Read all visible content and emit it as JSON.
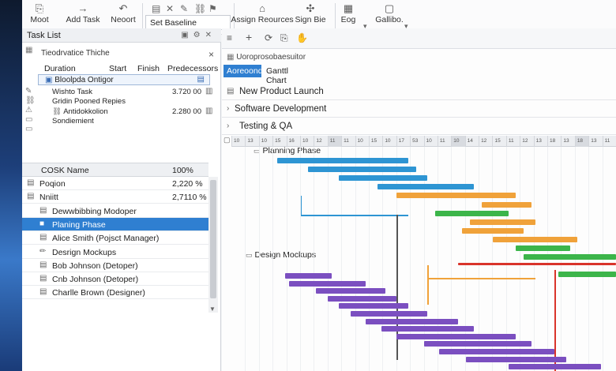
{
  "ribbon": {
    "buttons": [
      {
        "label": "Moot",
        "icon": "⎘"
      },
      {
        "label": "Add Task",
        "icon": "→"
      },
      {
        "label": "Neoort",
        "icon": "↶"
      },
      {
        "label": "Assign Reources",
        "icon": "⌂"
      },
      {
        "label": "Sign Bie",
        "icon": "✣"
      },
      {
        "label": "Eog",
        "icon": "▦"
      },
      {
        "label": "Gallibo.",
        "icon": "▢"
      }
    ],
    "baseline_label": "Set Baseline",
    "dropdown_arrow": "▾"
  },
  "task_list": {
    "title": "Task List",
    "properties_title": "Tieodrvatice Thiche",
    "close": "×",
    "columns": [
      "Duration",
      "Start",
      "Finish",
      "Predecessors"
    ],
    "selected_prop": "Bloolpda Ontigor",
    "props": [
      {
        "name": "Wishto Task",
        "value": "3.720 00"
      },
      {
        "name": "Gridin Pooned Repies",
        "value": ""
      },
      {
        "name": "Antidokkolion",
        "value": "2.280 00"
      },
      {
        "name": "Sondiemient",
        "value": ""
      }
    ],
    "grid_columns": [
      "COSK Name",
      "100%"
    ],
    "rows": [
      {
        "name": "Poqion",
        "pct": "2,220 %"
      },
      {
        "name": "Nniitt",
        "pct": "2,7110 %"
      },
      {
        "name": "Dewwbibbing Modoper",
        "pct": ""
      },
      {
        "name": "Planing Phase",
        "pct": "",
        "selected": true
      },
      {
        "name": "Alice Smith (Pojsct Manager)",
        "pct": ""
      },
      {
        "name": "Desrign Mockups",
        "pct": ""
      },
      {
        "name": "Bob Johnson (Detoper)",
        "pct": ""
      },
      {
        "name": "Cnb Johnson (Detoper)",
        "pct": ""
      },
      {
        "name": "Charlle Brown (Designer)",
        "pct": ""
      }
    ]
  },
  "gantt": {
    "toolbar_title": "Uoroprosobaesuitor",
    "tabs": [
      "Aoreoonde",
      "Ganttl Chart"
    ],
    "sections": [
      "New Product Launch",
      "Software Development",
      "Testing & QA"
    ],
    "ticks": [
      "10",
      "13",
      "10",
      "15",
      "16",
      "10",
      "12",
      "11",
      "11",
      "10",
      "15",
      "10",
      "17",
      "53",
      "10",
      "11",
      "10",
      "14",
      "12",
      "15",
      "11",
      "12",
      "13",
      "18",
      "13",
      "18",
      "13",
      "11"
    ],
    "labels": {
      "planning": "Planning Phase",
      "design": "Design Mockups"
    },
    "colors": {
      "blue": "#2e95d3",
      "orange": "#f0a23a",
      "green": "#3cb54a",
      "red": "#d9342b",
      "purple": "#7b4fc0",
      "accent": "#2f7fd1"
    },
    "bars": [
      {
        "color": "blue",
        "start": 0.12,
        "end": 0.46,
        "row": 0
      },
      {
        "color": "blue",
        "start": 0.2,
        "end": 0.48,
        "row": 1
      },
      {
        "color": "blue",
        "start": 0.28,
        "end": 0.51,
        "row": 2
      },
      {
        "color": "blue",
        "start": 0.38,
        "end": 0.63,
        "row": 3
      },
      {
        "color": "orange",
        "start": 0.43,
        "end": 0.74,
        "row": 4
      },
      {
        "color": "orange",
        "start": 0.65,
        "end": 0.78,
        "row": 5
      },
      {
        "color": "green",
        "start": 0.53,
        "end": 0.72,
        "row": 6
      },
      {
        "color": "orange",
        "start": 0.62,
        "end": 0.79,
        "row": 7
      },
      {
        "color": "orange",
        "start": 0.6,
        "end": 0.76,
        "row": 8
      },
      {
        "color": "orange",
        "start": 0.68,
        "end": 0.9,
        "row": 9
      },
      {
        "color": "green",
        "start": 0.74,
        "end": 0.88,
        "row": 10
      },
      {
        "color": "green",
        "start": 0.76,
        "end": 1.0,
        "row": 11
      },
      {
        "color": "red",
        "start": 0.59,
        "end": 1.0,
        "row": 12
      },
      {
        "color": "green",
        "start": 0.85,
        "end": 1.0,
        "row": 13
      },
      {
        "color": "purple",
        "start": 0.14,
        "end": 0.26,
        "row": 14
      },
      {
        "color": "purple",
        "start": 0.15,
        "end": 0.35,
        "row": 15
      },
      {
        "color": "purple",
        "start": 0.22,
        "end": 0.4,
        "row": 16
      },
      {
        "color": "purple",
        "start": 0.25,
        "end": 0.43,
        "row": 17
      },
      {
        "color": "purple",
        "start": 0.28,
        "end": 0.46,
        "row": 18
      },
      {
        "color": "purple",
        "start": 0.31,
        "end": 0.51,
        "row": 19
      },
      {
        "color": "purple",
        "start": 0.35,
        "end": 0.59,
        "row": 20
      },
      {
        "color": "purple",
        "start": 0.39,
        "end": 0.63,
        "row": 21
      },
      {
        "color": "purple",
        "start": 0.43,
        "end": 0.74,
        "row": 22
      },
      {
        "color": "purple",
        "start": 0.5,
        "end": 0.78,
        "row": 23
      },
      {
        "color": "purple",
        "start": 0.54,
        "end": 0.84,
        "row": 24
      },
      {
        "color": "purple",
        "start": 0.61,
        "end": 0.87,
        "row": 25
      },
      {
        "color": "purple",
        "start": 0.72,
        "end": 0.96,
        "row": 26
      }
    ]
  }
}
